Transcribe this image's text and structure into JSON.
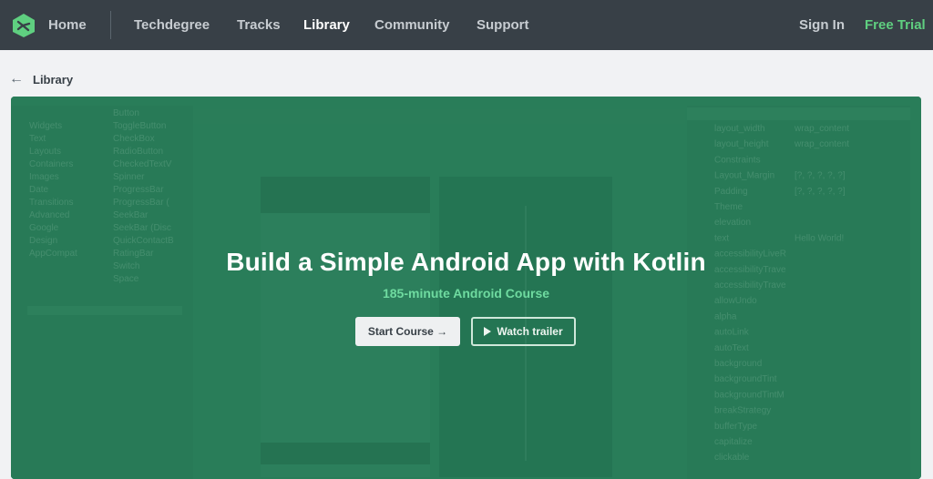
{
  "nav": {
    "logo_icon": "treehouse-logo-icon",
    "home": "Home",
    "links": [
      "Techdegree",
      "Tracks",
      "Library",
      "Community",
      "Support"
    ],
    "active": "Library",
    "sign_in": "Sign In",
    "free_trial": "Free Trial"
  },
  "breadcrumb": {
    "icon": "arrow-left-icon",
    "label": "Library"
  },
  "hero": {
    "title": "Build a Simple Android App with Kotlin",
    "subtitle": "185-minute Android Course",
    "start_course": "Start Course →",
    "watch_trailer": "Watch trailer",
    "play_icon": "play-icon",
    "bg_palette": [
      "Widgets",
      "Text",
      "Layouts",
      "Containers",
      "Images",
      "Date",
      "Transitions",
      "Advanced",
      "Google",
      "Design",
      "AppCompat"
    ],
    "bg_widgets": [
      "Button",
      "ToggleButton",
      "CheckBox",
      "RadioButton",
      "CheckedTextV",
      "Spinner",
      "ProgressBar",
      "ProgressBar (",
      "SeekBar",
      "SeekBar (Disc",
      "QuickContactB",
      "RatingBar",
      "Switch",
      "Space"
    ],
    "bg_attributes": [
      "layout_width",
      "layout_height",
      "Constraints",
      "Layout_Margin",
      "Padding",
      "Theme",
      "elevation",
      "text",
      "accessibilityLiveR",
      "accessibilityTrave",
      "accessibilityTrave",
      "allowUndo",
      "alpha",
      "autoLink",
      "autoText",
      "background",
      "backgroundTint",
      "backgroundTintM",
      "breakStrategy",
      "bufferType",
      "capitalize",
      "clickable"
    ],
    "bg_values": [
      "wrap_content",
      "wrap_content",
      "",
      "[?, ?, ?, ?, ?]",
      "[?, ?, ?, ?, ?]",
      "",
      "",
      "Hello World!"
    ],
    "colors": {
      "nav_bg": "#384047",
      "hero_overlay": "#217652",
      "subtitle": "#6fdba0",
      "free_trial": "#5fcf80"
    }
  }
}
